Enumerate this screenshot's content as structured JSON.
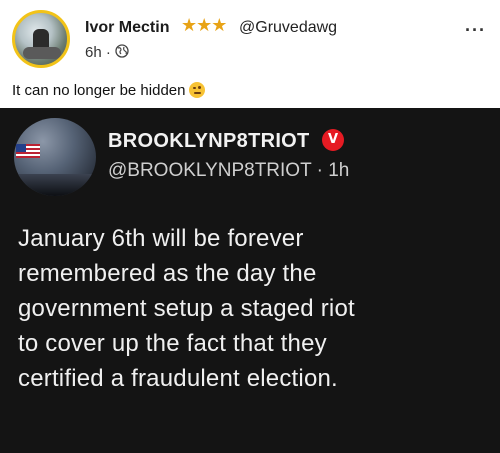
{
  "post": {
    "author_name": "Ivor Mectin",
    "stars": "★★★",
    "handle": "@Gruvedawg",
    "time": "6h ·",
    "more": "···",
    "caption": "It can no longer be hidden",
    "icons": {
      "visibility": "globe-icon",
      "more": "more-icon",
      "emoji": "winking-face-emoji"
    }
  },
  "embedded_tweet": {
    "name": "BROOKLYNP8TRIOT",
    "badge": "V",
    "handle": "@BROOKLYNP8TRIOT · 1h",
    "lines": [
      "January 6th will be forever",
      "remembered as the day the",
      "government setup a staged riot",
      "to cover up the fact that they",
      "certified a fraudulent election."
    ]
  },
  "colors": {
    "avatar_ring": "#f2c318",
    "star": "#e8a316",
    "tweet_bg": "#141414",
    "badge": "#e61b23"
  }
}
